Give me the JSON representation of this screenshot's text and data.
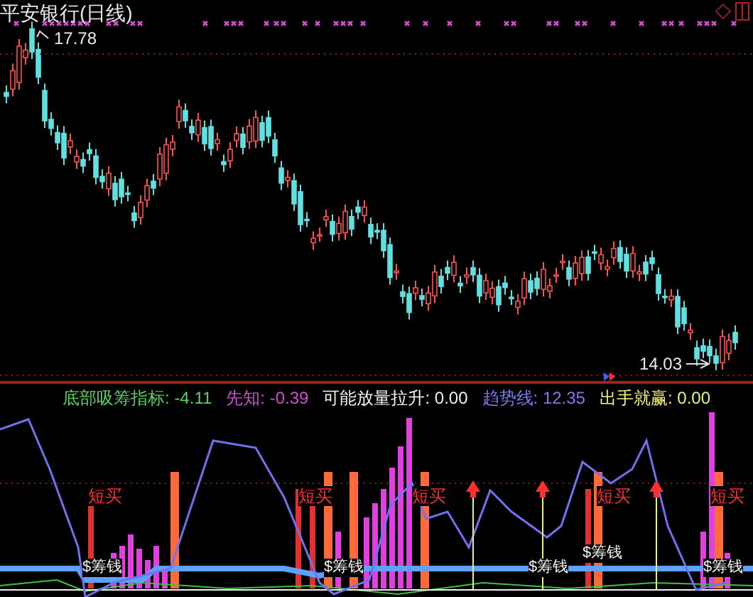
{
  "title": "平安银行(日线)",
  "price_chart": {
    "high_label": "17.78",
    "low_label": "14.03"
  },
  "indicator_header": [
    {
      "label": "底部吸筹指标:",
      "value": "-4.11",
      "color": "#5ad25a"
    },
    {
      "label": "先知:",
      "value": "-0.39",
      "color": "#d04fd0"
    },
    {
      "label": "可能放量拉升:",
      "value": "0.00",
      "color": "#f0f0f0"
    },
    {
      "label": "趋势线:",
      "value": "12.35",
      "color": "#7b7bf0"
    },
    {
      "label": "出手就赢:",
      "value": "0.00",
      "color": "#f0f07a"
    }
  ],
  "signal_labels": [
    "短买",
    "短买",
    "短买",
    "短买",
    "短买"
  ],
  "bottom_labels": [
    "$筹钱",
    "$筹钱",
    "$筹钱",
    "$筹钱",
    "$筹钱"
  ]
}
